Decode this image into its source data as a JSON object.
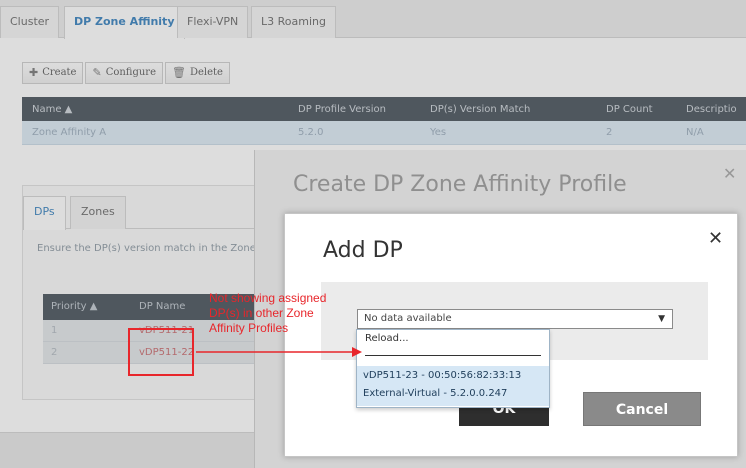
{
  "tabs": [
    "Cluster",
    "DP Zone Affinity",
    "Flexi-VPN",
    "L3 Roaming"
  ],
  "toolbar": {
    "create": "Create",
    "configure": "Configure",
    "delete": "Delete"
  },
  "grid": {
    "headers": [
      "Name ▲",
      "DP Profile Version",
      "DP(s) Version Match",
      "DP Count",
      "Descriptio"
    ],
    "row": [
      "Zone Affinity A",
      "5.2.0",
      "Yes",
      "2",
      "N/A"
    ]
  },
  "lower": {
    "tabs": [
      "DPs",
      "Zones"
    ],
    "note": "Ensure the DP(s) version match in the Zone",
    "headers": [
      "Priority ▲",
      "DP Name"
    ],
    "rows": [
      [
        "1",
        "vDP511-21"
      ],
      [
        "2",
        "vDP511-22"
      ]
    ]
  },
  "create_dialog": {
    "title": "Create DP Zone Affinity Profile",
    "close": "✕"
  },
  "add_dialog": {
    "title": "Add DP",
    "close": "✕",
    "select_value": "No data available",
    "ok": "OK",
    "cancel": "Cancel"
  },
  "dropdown": {
    "reload": "Reload...",
    "item_line1": "vDP511-23 - 00:50:56:82:33:13",
    "item_line2": "External-Virtual - 5.2.0.0.247"
  },
  "annotation": {
    "lines": [
      "Not showing assigned",
      "DP(s) in other Zone",
      "Affinity Profiles"
    ],
    "color": "#e8262b"
  }
}
